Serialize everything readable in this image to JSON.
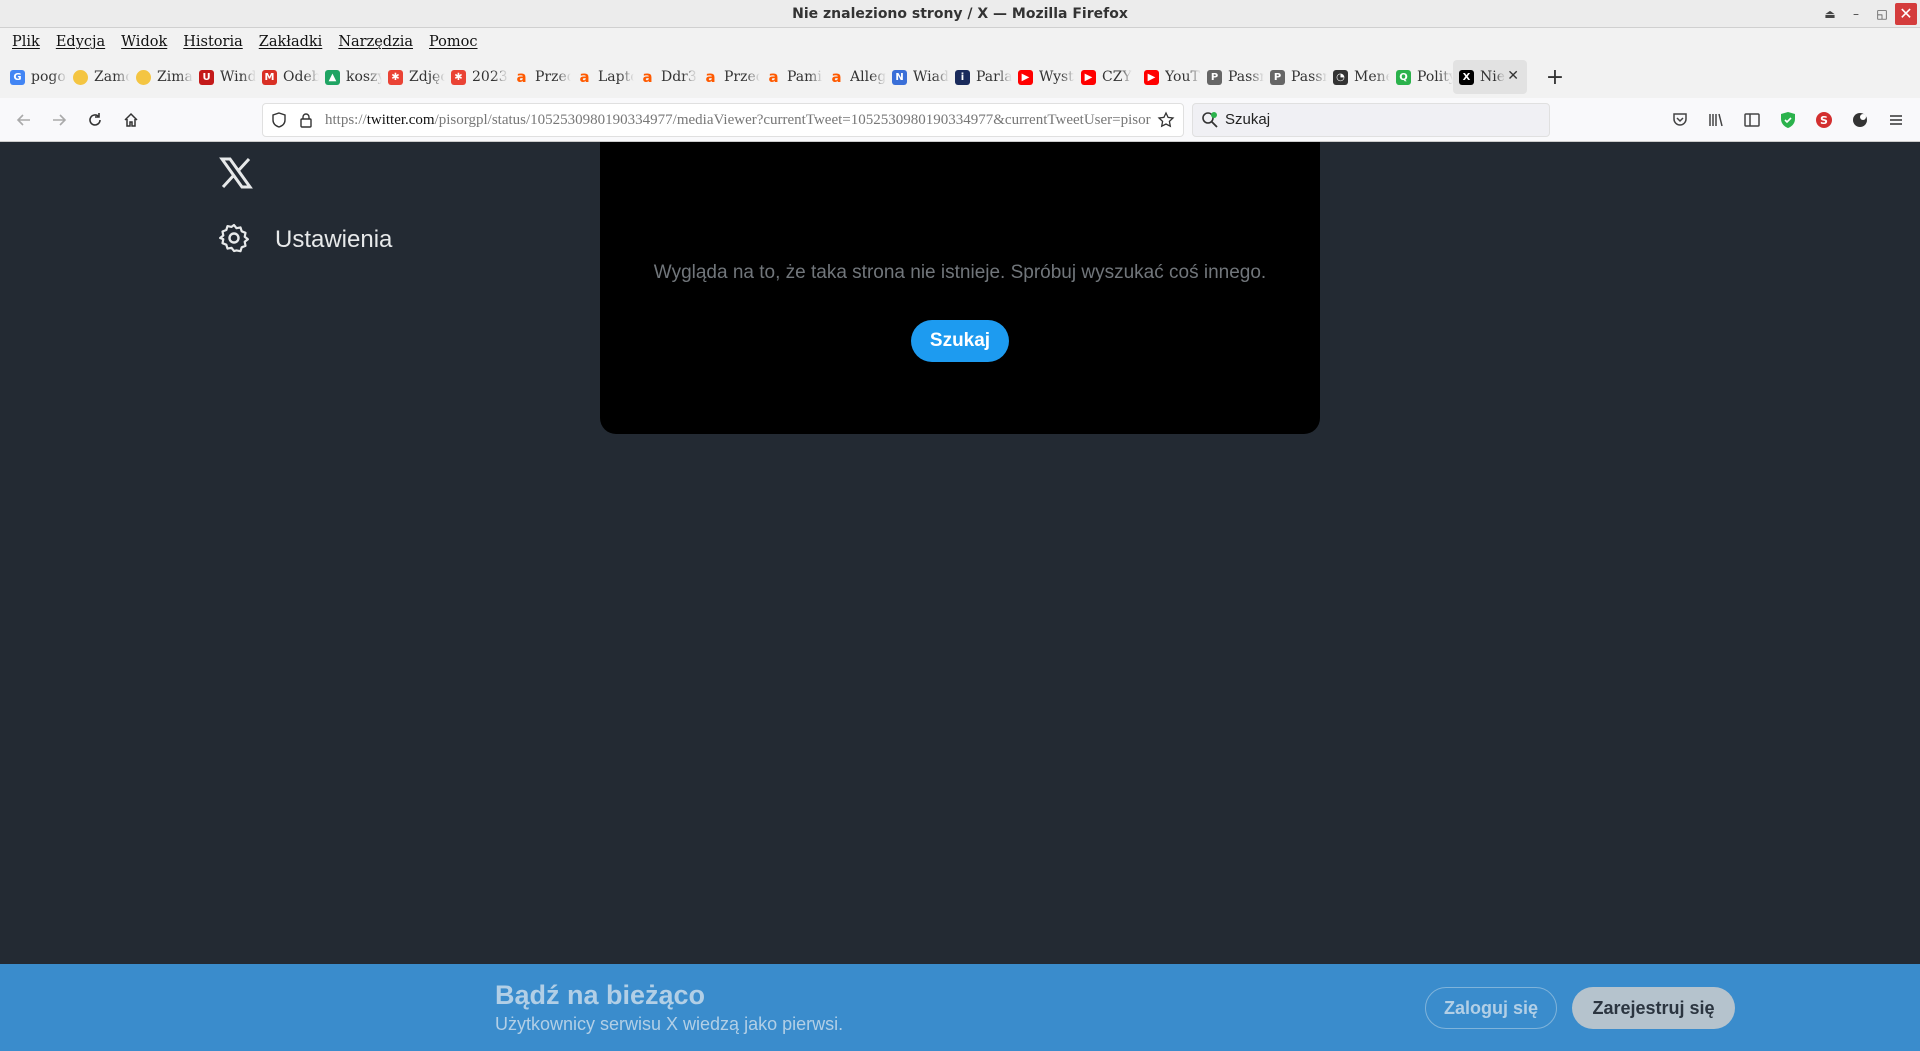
{
  "window": {
    "title": "Nie znaleziono strony / X — Mozilla Firefox"
  },
  "menubar": [
    "Plik",
    "Edycja",
    "Widok",
    "Historia",
    "Zakładki",
    "Narzędzia",
    "Pomoc"
  ],
  "tabs": [
    {
      "label": "pogoda",
      "icon": "google-icon",
      "color": "#4285f4"
    },
    {
      "label": "Zamów",
      "icon": "circle-icon",
      "color": "#f4c542"
    },
    {
      "label": "Zima",
      "icon": "circle-icon",
      "color": "#f4c542"
    },
    {
      "label": "Windows",
      "icon": "ublock-icon",
      "color": "#c41a1a"
    },
    {
      "label": "Odebrane",
      "icon": "gmail-icon",
      "color": "#d93025"
    },
    {
      "label": "koszyk",
      "icon": "drive-icon",
      "color": "#1fa463"
    },
    {
      "label": "Zdjęcia",
      "icon": "photos-icon",
      "color": "#ea4335"
    },
    {
      "label": "2023",
      "icon": "photos-icon",
      "color": "#ea4335"
    },
    {
      "label": "Przed",
      "icon": "allegro-icon",
      "color": "#ff5a00"
    },
    {
      "label": "Laptop",
      "icon": "allegro-icon",
      "color": "#ff5a00"
    },
    {
      "label": "Ddr3",
      "icon": "allegro-icon",
      "color": "#ff5a00"
    },
    {
      "label": "Przed",
      "icon": "allegro-icon",
      "color": "#ff5a00"
    },
    {
      "label": "Pamięć",
      "icon": "allegro-icon",
      "color": "#ff5a00"
    },
    {
      "label": "Allegro",
      "icon": "allegro-icon",
      "color": "#ff5a00"
    },
    {
      "label": "Wiadomości",
      "icon": "news-icon",
      "color": "#3a6fd8"
    },
    {
      "label": "Parlament",
      "icon": "int-icon",
      "color": "#1a2b5c"
    },
    {
      "label": "Wystąpienie",
      "icon": "youtube-icon",
      "color": "#ff0000"
    },
    {
      "label": "CZY",
      "icon": "youtube-icon",
      "color": "#ff0000"
    },
    {
      "label": "YouTube",
      "icon": "youtube-icon",
      "color": "#ff0000"
    },
    {
      "label": "Passmark",
      "icon": "passmark-icon",
      "color": "#666666"
    },
    {
      "label": "Passmark",
      "icon": "passmark-icon",
      "color": "#666666"
    },
    {
      "label": "Menedżer",
      "icon": "gauge-icon",
      "color": "#333333"
    },
    {
      "label": "Polityka",
      "icon": "polityka-icon",
      "color": "#2bb24c"
    },
    {
      "label": "Nie",
      "icon": "x-icon",
      "color": "#000000",
      "active": true
    }
  ],
  "navbar": {
    "url_prefix": "https://",
    "url_host": "twitter.com",
    "url_rest": "/pisorgpl/status/1052530980190334977/mediaViewer?currentTweet=1052530980190334977&currentTweetUser=pisorgpl",
    "search_placeholder": "Szukaj"
  },
  "sidebar": {
    "settings_label": "Ustawienia"
  },
  "modal": {
    "message": "Wygląda na to, że taka strona nie istnieje. Spróbuj wyszukać coś innego.",
    "search_button": "Szukaj"
  },
  "banner": {
    "title": "Bądź na bieżąco",
    "subtitle": "Użytkownicy serwisu X wiedzą jako pierwsi.",
    "login": "Zaloguj się",
    "signup": "Zarejestruj się"
  },
  "colors": {
    "accent": "#1d9bf0",
    "banner": "#3a8ccc",
    "page_bg": "#232a33"
  }
}
